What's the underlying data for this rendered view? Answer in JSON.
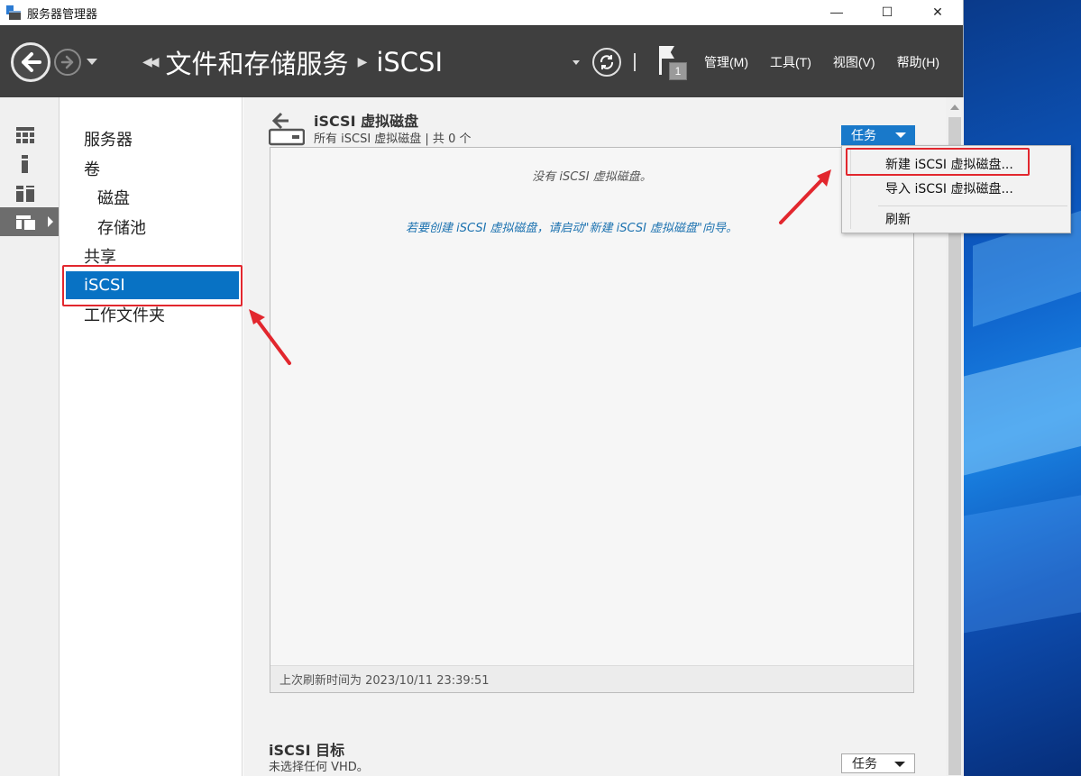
{
  "window": {
    "title": "服务器管理器",
    "controls": {
      "minimize": "—",
      "maximize": "☐",
      "close": "✕"
    }
  },
  "header": {
    "breadcrumbs": [
      "文件和存储服务",
      "iSCSI"
    ],
    "notification_count": "1",
    "menu": [
      "管理(M)",
      "工具(T)",
      "视图(V)",
      "帮助(H)"
    ]
  },
  "iconstrip": {
    "items": [
      "dashboard-icon",
      "local-server-icon",
      "all-servers-icon",
      "file-storage-icon"
    ],
    "active_index": 3
  },
  "sidebar": {
    "items": [
      {
        "label": "服务器",
        "level": 0
      },
      {
        "label": "卷",
        "level": 0
      },
      {
        "label": "磁盘",
        "level": 1
      },
      {
        "label": "存储池",
        "level": 1
      },
      {
        "label": "共享",
        "level": 0
      },
      {
        "label": "iSCSI",
        "level": 0,
        "selected": true
      },
      {
        "label": "工作文件夹",
        "level": 0
      }
    ]
  },
  "virtual_disks": {
    "title": "iSCSI 虚拟磁盘",
    "subtitle": "所有 iSCSI 虚拟磁盘 | 共 0 个",
    "tasks_label": "任务",
    "empty_message": "没有 iSCSI 虚拟磁盘。",
    "hint_message": "若要创建 iSCSI 虚拟磁盘，请启动\"新建 iSCSI 虚拟磁盘\"向导。",
    "last_refresh": "上次刷新时间为 2023/10/11 23:39:51"
  },
  "tasks_menu": {
    "items": [
      "新建 iSCSI 虚拟磁盘...",
      "导入 iSCSI 虚拟磁盘...",
      "刷新"
    ]
  },
  "targets": {
    "title": "iSCSI 目标",
    "subtitle": "未选择任何 VHD。",
    "tasks_label": "任务"
  },
  "colors": {
    "accent": "#0872c4",
    "command_bar": "#3f3f3f",
    "annotation_red": "#e2272e"
  }
}
